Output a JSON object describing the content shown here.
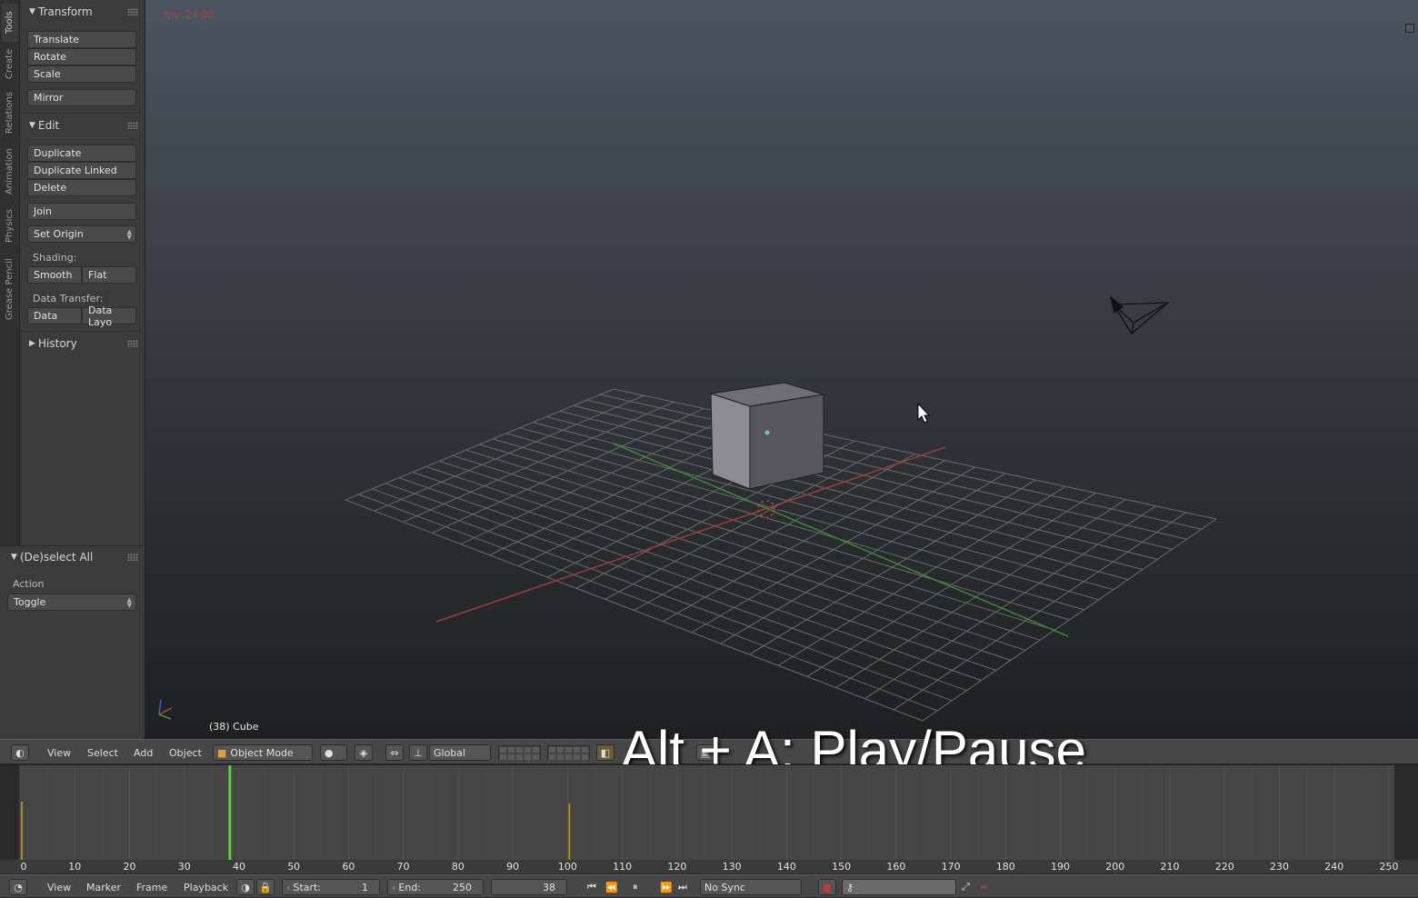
{
  "tool_tabs": [
    "Tools",
    "Create",
    "Relations",
    "Animation",
    "Physics",
    "Grease Pencil"
  ],
  "tool_shelf": {
    "transform": {
      "title": "Transform",
      "buttons": [
        "Translate",
        "Rotate",
        "Scale",
        "Mirror"
      ]
    },
    "edit": {
      "title": "Edit",
      "buttons": [
        "Duplicate",
        "Duplicate Linked",
        "Delete",
        "Join"
      ],
      "set_origin": "Set Origin",
      "shading_label": "Shading:",
      "shading_smooth": "Smooth",
      "shading_flat": "Flat",
      "data_transfer_label": "Data Transfer:",
      "data": "Data",
      "data_layout": "Data Layo"
    },
    "history": {
      "title": "History"
    }
  },
  "operator_panel": {
    "title": "(De)select All",
    "action_label": "Action",
    "action_value": "Toggle"
  },
  "viewport": {
    "fps": "fps: 24.00",
    "object_label": "(38) Cube",
    "caption": "Alt + A: Play/Pause"
  },
  "view3d_header": {
    "menus": [
      "View",
      "Select",
      "Add",
      "Object"
    ],
    "mode": "Object Mode",
    "orientation": "Global"
  },
  "timeline": {
    "current_frame": 38,
    "start": 1,
    "end": 250,
    "keyframe_marks": [
      0,
      100
    ],
    "ruler_labels": [
      "0",
      "10",
      "20",
      "30",
      "40",
      "50",
      "60",
      "70",
      "80",
      "90",
      "100",
      "110",
      "120",
      "130",
      "140",
      "150",
      "160",
      "170",
      "180",
      "190",
      "200",
      "210",
      "220",
      "230",
      "240",
      "250"
    ]
  },
  "timeline_header": {
    "menus": [
      "View",
      "Marker",
      "Frame",
      "Playback"
    ],
    "start_label": "Start:",
    "start_value": "1",
    "end_label": "End:",
    "end_value": "250",
    "frame_value": "38",
    "sync": "No Sync"
  },
  "colors": {
    "x_axis": "#b23a3a",
    "y_axis": "#3a9a3a",
    "current_frame": "#5ad23c",
    "keyframe": "#c8a020",
    "record": "#d23232"
  }
}
